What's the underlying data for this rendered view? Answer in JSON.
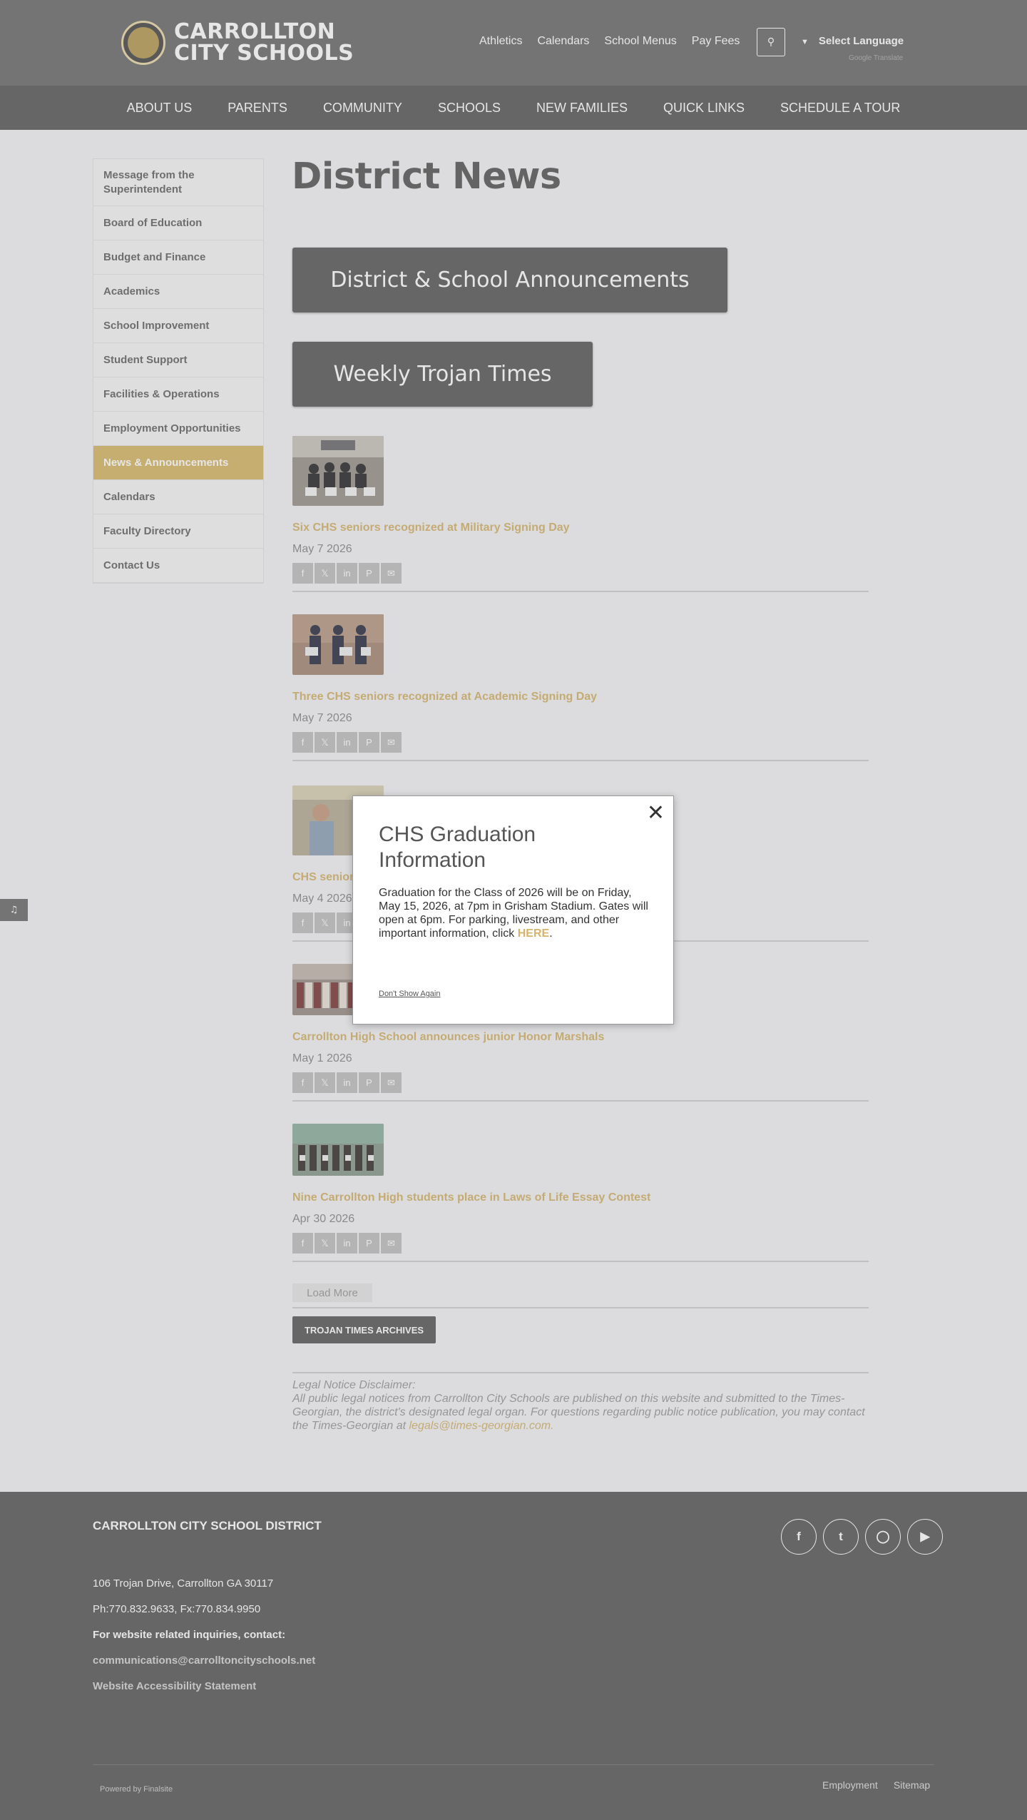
{
  "header": {
    "logo_text_line1": "CARROLLTON",
    "logo_text_line2": "CITY SCHOOLS",
    "util_links": [
      "Athletics",
      "Calendars",
      "School Menus",
      "Pay Fees"
    ],
    "language": "Select Language",
    "powered_by": "Google Translate"
  },
  "mainnav": [
    "ABOUT US",
    "PARENTS",
    "COMMUNITY",
    "SCHOOLS",
    "NEW FAMILIES",
    "QUICK LINKS",
    "SCHEDULE A TOUR"
  ],
  "sidebar": {
    "items": [
      "Message from the Superintendent",
      "Board of Education",
      "Budget and Finance",
      "Academics",
      "School Improvement",
      "Student Support",
      "Facilities & Operations",
      "Employment Opportunities",
      "News & Announcements",
      "Calendars",
      "Faculty Directory",
      "Contact Us"
    ],
    "active_index": 8
  },
  "main": {
    "title": "District News",
    "btn_announcements": "District & School Announcements",
    "btn_trojan": "Weekly Trojan Times",
    "news": [
      {
        "title": "Six CHS seniors recognized at Military Signing Day",
        "date": "May 7 2026"
      },
      {
        "title": "Three CHS seniors recognized at Academic Signing Day",
        "date": "May 7 2026"
      },
      {
        "title": "CHS seniors",
        "date": "May 4 2026"
      },
      {
        "title": "Carrollton High School announces junior Honor Marshals",
        "date": "May 1 2026"
      },
      {
        "title": "Nine Carrollton High students place in Laws of Life Essay Contest",
        "date": "Apr 30 2026"
      }
    ],
    "load_more": "Load More",
    "archives": "TROJAN TIMES ARCHIVES",
    "legal_heading": "Legal Notice Disclaimer:",
    "legal_text": "All public legal notices from Carrollton City Schools are published on this website and submitted to the Times-Georgian, the district's designated legal organ. For questions regarding public notice publication, you may contact the Times-Georgian at",
    "legal_email": "legals@times-georgian.com."
  },
  "footer": {
    "title": "CARROLLTON CITY SCHOOL DISTRICT",
    "address": "106 Trojan Drive, Carrollton GA 30117",
    "phone": "Ph:770.832.9633, Fx:770.834.9950",
    "contact_label": "For website related inquiries, contact:",
    "contact_email": "communications@carrolltoncityschools.net",
    "accessibility": "Website Accessibility Statement",
    "powered": "Powered by Finalsite",
    "bottom_links": [
      "Employment",
      "Sitemap"
    ]
  },
  "modal": {
    "title": "CHS Graduation Information",
    "body": "Graduation for the Class of 2026 will be on Friday, May 15, 2026, at 7pm in Grisham Stadium. Gates will open at 6pm. For parking, livestream, and other important information, click",
    "link": "HERE",
    "dismiss": "Don't Show Again"
  }
}
